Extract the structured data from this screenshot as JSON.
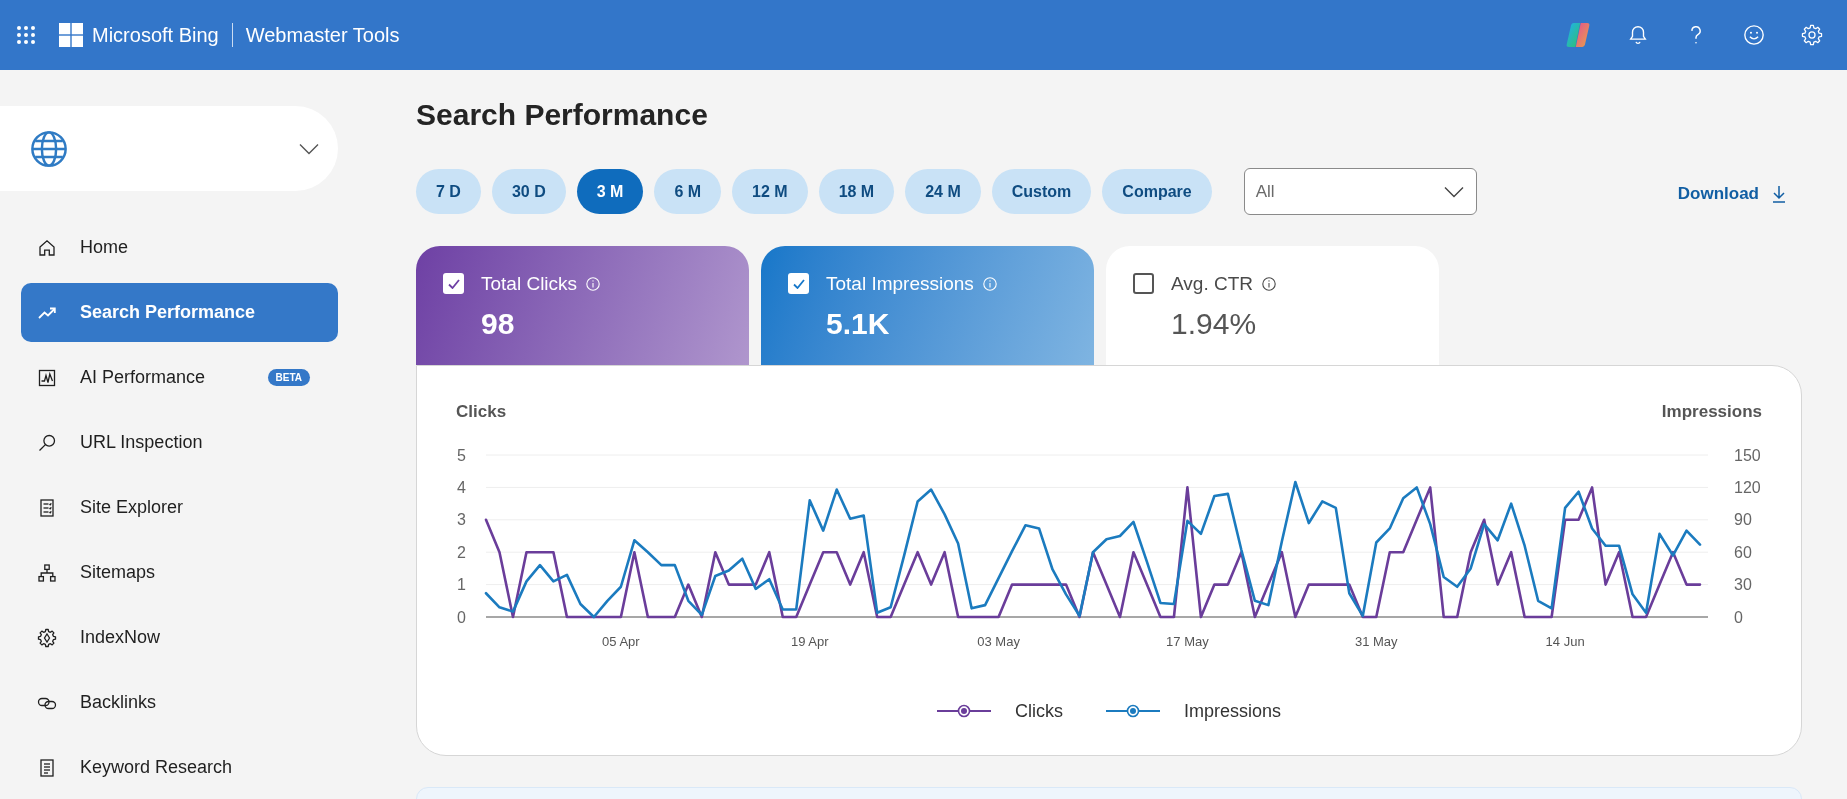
{
  "header": {
    "brand": "Microsoft Bing",
    "product": "Webmaster Tools"
  },
  "sidebar": {
    "items": [
      {
        "label": "Home",
        "selected": false
      },
      {
        "label": "Search Performance",
        "selected": true
      },
      {
        "label": "AI Performance",
        "selected": false,
        "badge": "BETA"
      },
      {
        "label": "URL Inspection",
        "selected": false
      },
      {
        "label": "Site Explorer",
        "selected": false
      },
      {
        "label": "Sitemaps",
        "selected": false
      },
      {
        "label": "IndexNow",
        "selected": false
      },
      {
        "label": "Backlinks",
        "selected": false
      },
      {
        "label": "Keyword Research",
        "selected": false
      }
    ]
  },
  "page": {
    "title": "Search Performance",
    "periods": [
      {
        "label": "7 D",
        "selected": false
      },
      {
        "label": "30 D",
        "selected": false
      },
      {
        "label": "3 M",
        "selected": true
      },
      {
        "label": "6 M",
        "selected": false
      },
      {
        "label": "12 M",
        "selected": false
      },
      {
        "label": "18 M",
        "selected": false
      },
      {
        "label": "24 M",
        "selected": false
      },
      {
        "label": "Custom",
        "selected": false
      },
      {
        "label": "Compare",
        "selected": false
      }
    ],
    "filter": {
      "value": "All"
    },
    "download": {
      "label": "Download"
    },
    "metrics": [
      {
        "label": "Total Clicks",
        "value": "98",
        "checked": true,
        "color": "#6e40a4"
      },
      {
        "label": "Total Impressions",
        "value": "5.1K",
        "checked": true,
        "color": "#1677c9"
      },
      {
        "label": "Avg. CTR",
        "value": "1.94%",
        "checked": false
      }
    ],
    "chart": {
      "chart_data": {
        "type": "line",
        "ylabel": "Clicks",
        "y2label": "Impressions",
        "grid": true,
        "categories": [
          null,
          null,
          null,
          null,
          null,
          null,
          null,
          null,
          null,
          null,
          "05 Apr",
          null,
          null,
          null,
          null,
          null,
          null,
          null,
          null,
          null,
          null,
          null,
          null,
          null,
          "19 Apr",
          null,
          null,
          null,
          null,
          null,
          null,
          null,
          null,
          null,
          null,
          null,
          null,
          null,
          "03 May",
          null,
          null,
          null,
          null,
          null,
          null,
          null,
          null,
          null,
          null,
          null,
          null,
          null,
          "17 May",
          null,
          null,
          null,
          null,
          null,
          null,
          null,
          null,
          null,
          null,
          null,
          null,
          null,
          "31 May",
          null,
          null,
          null,
          null,
          null,
          null,
          null,
          null,
          null,
          null,
          null,
          null,
          null,
          "14 Jun",
          null,
          null,
          null,
          null,
          null,
          null,
          null,
          null,
          null,
          null
        ],
        "ylim": [
          0,
          5
        ],
        "yticks": [
          0,
          1,
          2,
          3,
          4,
          5
        ],
        "y2lim": [
          0,
          150
        ],
        "y2ticks": [
          0,
          30,
          60,
          90,
          120,
          150
        ],
        "series": [
          {
            "name": "Clicks",
            "color": "#6a3d9a",
            "values": [
              3,
              2,
              0,
              2,
              2,
              2,
              0,
              0,
              0,
              0,
              0,
              2,
              0,
              0,
              0,
              1,
              0,
              2,
              1,
              1,
              1,
              2,
              0,
              0,
              1,
              2,
              2,
              1,
              2,
              0,
              0,
              1,
              2,
              1,
              2,
              0,
              0,
              0,
              0,
              1,
              1,
              1,
              1,
              1,
              0,
              2,
              1,
              0,
              2,
              1,
              0,
              0,
              4,
              0,
              1,
              1,
              2,
              0,
              1,
              2,
              0,
              1,
              1,
              1,
              1,
              0,
              0,
              2,
              2,
              3,
              4,
              0,
              0,
              2,
              3,
              1,
              2,
              0,
              0,
              0,
              3,
              3,
              4,
              1,
              2,
              0,
              0,
              1,
              2,
              1,
              1
            ]
          },
          {
            "name": "Impressions",
            "color": "#1b7bbf",
            "axis": "y2",
            "values": [
              22,
              9,
              5,
              33,
              48,
              33,
              39,
              12,
              0,
              15,
              28,
              71,
              60,
              48,
              48,
              15,
              2,
              38,
              43,
              54,
              26,
              35,
              7,
              7,
              108,
              80,
              118,
              91,
              94,
              4,
              9,
              57,
              107,
              118,
              95,
              68,
              8,
              11,
              36,
              61,
              85,
              82,
              44,
              21,
              1,
              60,
              72,
              75,
              88,
              51,
              13,
              12,
              89,
              77,
              112,
              114,
              62,
              15,
              11,
              70,
              125,
              87,
              107,
              101,
              22,
              1,
              69,
              82,
              110,
              120,
              86,
              37,
              28,
              45,
              86,
              71,
              105,
              66,
              15,
              8,
              101,
              116,
              82,
              66,
              66,
              21,
              4,
              77,
              57,
              80,
              67
            ]
          }
        ]
      }
    }
  }
}
